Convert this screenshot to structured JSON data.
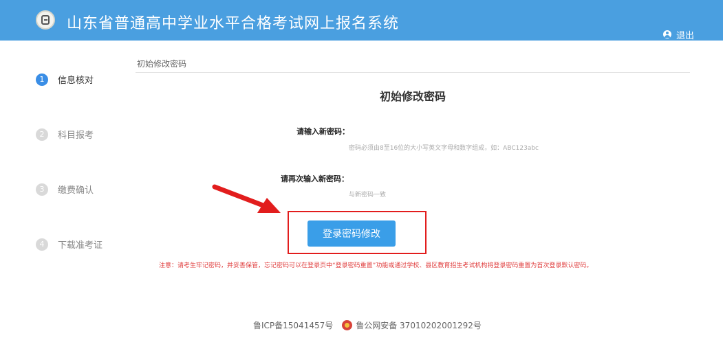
{
  "header": {
    "title": "山东省普通高中学业水平合格考试网上报名系统",
    "logout_label": "退出"
  },
  "steps": [
    {
      "num": "1",
      "label": "信息核对",
      "active": true
    },
    {
      "num": "2",
      "label": "科目报考",
      "active": false
    },
    {
      "num": "3",
      "label": "缴费确认",
      "active": false
    },
    {
      "num": "4",
      "label": "下载准考证",
      "active": false
    }
  ],
  "breadcrumb": "初始修改密码",
  "form": {
    "title": "初始修改密码",
    "new_password_label": "请输入新密码：",
    "new_password_placeholder": "密码必须由8至16位的大小写英文字母和数字组成，如：ABC123abc",
    "confirm_password_label": "请再次输入新密码：",
    "confirm_password_placeholder": "与新密码一致",
    "submit_label": "登录密码修改"
  },
  "notice": "注意：请考生牢记密码，并妥善保管，忘记密码可以在登录页中“登录密码重置”功能或通过学校、县区教育招生考试机构将登录密码重置为首次登录默认密码。",
  "footer": {
    "icp": "鲁ICP备15041457号",
    "police": "鲁公网安备 37010202001292号"
  },
  "colors": {
    "header_bg": "#4a9fe0",
    "primary_button": "#3a9ee8",
    "highlight_red": "#e21d1d",
    "notice_red": "#e04040"
  }
}
